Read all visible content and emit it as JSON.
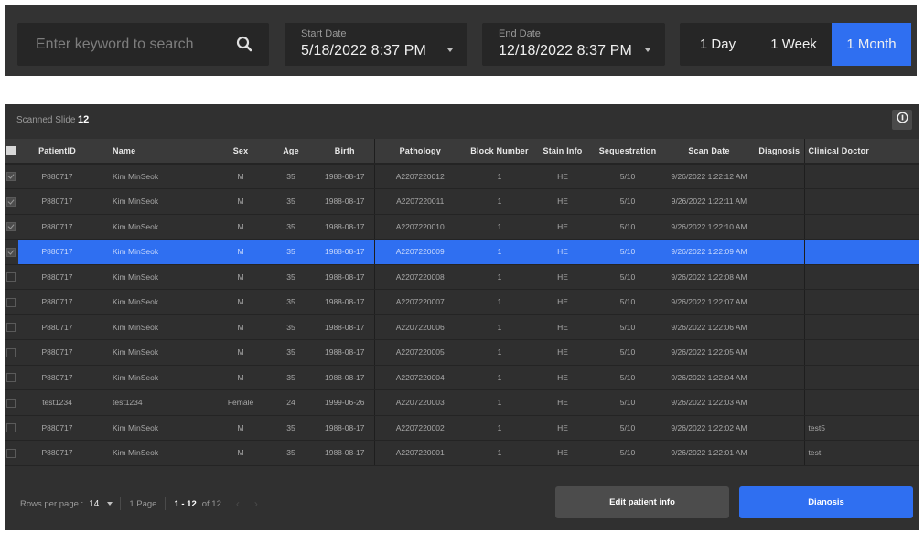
{
  "filters": {
    "search": {
      "placeholder": "Enter keyword to search",
      "value": "",
      "icon": "search-icon"
    },
    "start_date": {
      "label": "Start Date",
      "value": "5/18/2022 8:37 PM"
    },
    "end_date": {
      "label": "End Date",
      "value": "12/18/2022 8:37 PM"
    },
    "ranges": [
      {
        "label": "1 Day",
        "active": false
      },
      {
        "label": "1 Week",
        "active": false
      },
      {
        "label": "1 Month",
        "active": true
      }
    ]
  },
  "panel": {
    "scanned_label": "Scanned Slide",
    "scanned_count": "12",
    "info_icon": "info-icon"
  },
  "table": {
    "columns": [
      "PatientID",
      "Name",
      "Sex",
      "Age",
      "Birth",
      "Pathology",
      "Block Number",
      "Stain Info",
      "Sequestration",
      "Scan Date",
      "Diagnosis",
      "Clinical Doctor"
    ],
    "rows": [
      {
        "checked": true,
        "selected": false,
        "cells": [
          "P880717",
          "Kim MinSeok",
          "M",
          "35",
          "1988-08-17",
          "A2207220012",
          "1",
          "HE",
          "5/10",
          "9/26/2022 1:22:12 AM",
          "",
          ""
        ]
      },
      {
        "checked": true,
        "selected": false,
        "cells": [
          "P880717",
          "Kim MinSeok",
          "M",
          "35",
          "1988-08-17",
          "A2207220011",
          "1",
          "HE",
          "5/10",
          "9/26/2022 1:22:11 AM",
          "",
          ""
        ]
      },
      {
        "checked": true,
        "selected": false,
        "cells": [
          "P880717",
          "Kim MinSeok",
          "M",
          "35",
          "1988-08-17",
          "A2207220010",
          "1",
          "HE",
          "5/10",
          "9/26/2022 1:22:10 AM",
          "",
          ""
        ]
      },
      {
        "checked": true,
        "selected": true,
        "cells": [
          "P880717",
          "Kim MinSeok",
          "M",
          "35",
          "1988-08-17",
          "A2207220009",
          "1",
          "HE",
          "5/10",
          "9/26/2022 1:22:09 AM",
          "",
          ""
        ]
      },
      {
        "checked": false,
        "selected": false,
        "cells": [
          "P880717",
          "Kim MinSeok",
          "M",
          "35",
          "1988-08-17",
          "A2207220008",
          "1",
          "HE",
          "5/10",
          "9/26/2022 1:22:08 AM",
          "",
          ""
        ]
      },
      {
        "checked": false,
        "selected": false,
        "cells": [
          "P880717",
          "Kim MinSeok",
          "M",
          "35",
          "1988-08-17",
          "A2207220007",
          "1",
          "HE",
          "5/10",
          "9/26/2022 1:22:07 AM",
          "",
          ""
        ]
      },
      {
        "checked": false,
        "selected": false,
        "cells": [
          "P880717",
          "Kim MinSeok",
          "M",
          "35",
          "1988-08-17",
          "A2207220006",
          "1",
          "HE",
          "5/10",
          "9/26/2022 1:22:06 AM",
          "",
          ""
        ]
      },
      {
        "checked": false,
        "selected": false,
        "cells": [
          "P880717",
          "Kim MinSeok",
          "M",
          "35",
          "1988-08-17",
          "A2207220005",
          "1",
          "HE",
          "5/10",
          "9/26/2022 1:22:05 AM",
          "",
          ""
        ]
      },
      {
        "checked": false,
        "selected": false,
        "cells": [
          "P880717",
          "Kim MinSeok",
          "M",
          "35",
          "1988-08-17",
          "A2207220004",
          "1",
          "HE",
          "5/10",
          "9/26/2022 1:22:04 AM",
          "",
          ""
        ]
      },
      {
        "checked": false,
        "selected": false,
        "cells": [
          "test1234",
          "test1234",
          "Female",
          "24",
          "1999-06-26",
          "A2207220003",
          "1",
          "HE",
          "5/10",
          "9/26/2022 1:22:03 AM",
          "",
          ""
        ]
      },
      {
        "checked": false,
        "selected": false,
        "cells": [
          "P880717",
          "Kim MinSeok",
          "M",
          "35",
          "1988-08-17",
          "A2207220002",
          "1",
          "HE",
          "5/10",
          "9/26/2022 1:22:02 AM",
          "",
          "test5"
        ]
      },
      {
        "checked": false,
        "selected": false,
        "cells": [
          "P880717",
          "Kim MinSeok",
          "M",
          "35",
          "1988-08-17",
          "A2207220001",
          "1",
          "HE",
          "5/10",
          "9/26/2022 1:22:01 AM",
          "",
          "test"
        ]
      }
    ]
  },
  "pagination": {
    "rows_per_page_label": "Rows per page :",
    "rows_per_page_value": "14",
    "page_label": "1 Page",
    "range": "1 - 12",
    "total": "of 12",
    "prev_symbol": "‹",
    "next_symbol": "›"
  },
  "actions": {
    "edit_label": "Edit patient info",
    "diagnosis_label": "Dianosis"
  },
  "colors": {
    "accent": "#2f6ff1",
    "panel_bg": "#303030",
    "topbar_bg": "#333333",
    "field_bg": "#262626"
  }
}
